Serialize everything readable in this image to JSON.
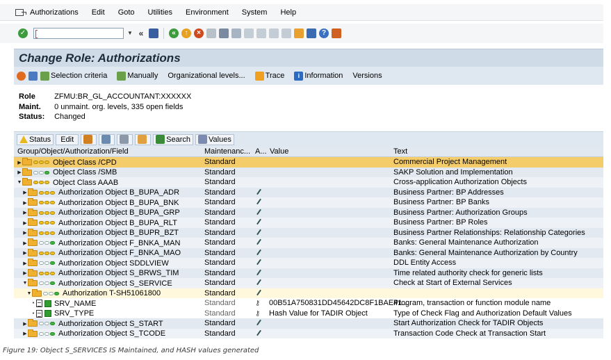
{
  "menubar": {
    "items": [
      "Authorizations",
      "Edit",
      "Goto",
      "Utilities",
      "Environment",
      "System",
      "Help"
    ]
  },
  "toolbar": {
    "command_value": "",
    "icons": [
      "ok-icon",
      "command-field",
      "back-double-icon",
      "save-icon",
      "back-icon",
      "exit-icon",
      "cancel-icon",
      "print-icon",
      "find-icon",
      "find-next-icon",
      "first-page-icon",
      "prev-page-icon",
      "next-page-icon",
      "last-page-icon",
      "new-session-icon",
      "shortcut-icon",
      "help-icon",
      "layout-icon"
    ]
  },
  "title": "Change Role: Authorizations",
  "app_toolbar": {
    "selection_criteria": "Selection criteria",
    "manually": "Manually",
    "org_levels": "Organizational levels...",
    "trace": "Trace",
    "information": "Information",
    "versions": "Versions"
  },
  "header": {
    "role_label": "Role",
    "role_value": "ZFMU:BR_GL_ACCOUNTANT:XXXXXX",
    "maint_label": "Maint.",
    "maint_value": "0 unmaint. org. levels, 335 open fields",
    "status_label": "Status:",
    "status_value": "Changed"
  },
  "tree_toolbar": {
    "status": "Status",
    "edit": "Edit",
    "search": "Search",
    "values": "Values"
  },
  "tree": {
    "columns": {
      "name": "Group/Object/Authorization/Field",
      "maint": "Maintenanc...",
      "a": "A...",
      "value": "Value",
      "text": "Text"
    },
    "rows": [
      {
        "name": "Object Class /CPD",
        "maint": "Standard",
        "value": "",
        "text": "Commercial Project Management"
      },
      {
        "name": "Object Class /SMB",
        "maint": "Standard",
        "value": "",
        "text": "SAKP Solution and Implementation"
      },
      {
        "name": "Object Class AAAB",
        "maint": "Standard",
        "value": "",
        "text": "Cross-application Authorization Objects"
      },
      {
        "name": "Authorization Object B_BUPA_ADR",
        "maint": "Standard",
        "value": "",
        "text": "Business Partner: BP Addresses"
      },
      {
        "name": "Authorization Object B_BUPA_BNK",
        "maint": "Standard",
        "value": "",
        "text": "Business Partner: BP Banks"
      },
      {
        "name": "Authorization Object B_BUPA_GRP",
        "maint": "Standard",
        "value": "",
        "text": "Business Partner: Authorization Groups"
      },
      {
        "name": "Authorization Object B_BUPA_RLT",
        "maint": "Standard",
        "value": "",
        "text": "Business Partner: BP Roles"
      },
      {
        "name": "Authorization Object B_BUPR_BZT",
        "maint": "Standard",
        "value": "",
        "text": "Business Partner Relationships: Relationship Categories"
      },
      {
        "name": "Authorization Object F_BNKA_MAN",
        "maint": "Standard",
        "value": "",
        "text": "Banks: General Maintenance Authorization"
      },
      {
        "name": "Authorization Object F_BNKA_MAO",
        "maint": "Standard",
        "value": "",
        "text": "Banks: General Maintenance Authorization by Country"
      },
      {
        "name": "Authorization Object SDDLVIEW",
        "maint": "Standard",
        "value": "",
        "text": "DDL Entity Access"
      },
      {
        "name": "Authorization Object S_BRWS_TIM",
        "maint": "Standard",
        "value": "",
        "text": "Time related authority check for generic lists"
      },
      {
        "name": "Authorization Object S_SERVICE",
        "maint": "Standard",
        "value": "",
        "text": "Check at Start of External Services"
      },
      {
        "name": "Authorization T-SH51061800",
        "maint": "Standard",
        "value": "",
        "text": ""
      },
      {
        "name": "SRV_NAME",
        "maint": "Standard",
        "value": "00B51A750831DD45642DC8F1BAE41...",
        "text": "Program, transaction or function module name"
      },
      {
        "name": "SRV_TYPE",
        "maint": "Standard",
        "value": "Hash Value for TADIR Object",
        "text": "Type of Check Flag and Authorization Default Values"
      },
      {
        "name": "Authorization Object S_START",
        "maint": "Standard",
        "value": "",
        "text": "Start Authorization Check for TADIR Objects"
      },
      {
        "name": "Authorization Object S_TCODE",
        "maint": "Standard",
        "value": "",
        "text": "Transaction Code Check at Transaction Start"
      }
    ]
  },
  "caption": "Figure 19: Object S_SERVICES IS Maintained, and HASH values generated"
}
